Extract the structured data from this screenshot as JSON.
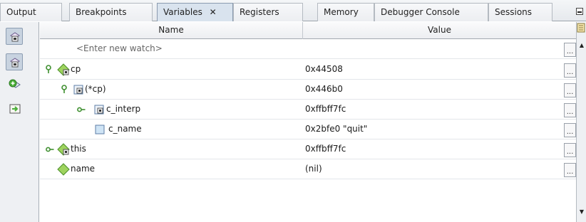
{
  "tabs": [
    {
      "label": "Output"
    },
    {
      "label": "Breakpoints"
    },
    {
      "label": "Variables",
      "active": true,
      "close": "✕"
    },
    {
      "label": "Registers"
    },
    {
      "label": "Memory"
    },
    {
      "label": "Debugger Console"
    },
    {
      "label": "Sessions"
    }
  ],
  "table": {
    "columns": {
      "name": "Name",
      "value": "Value"
    },
    "new_watch_placeholder": "<Enter new watch>",
    "ellipsis": "...",
    "rows": [
      {
        "name": "cp",
        "value": "0x44508"
      },
      {
        "name": "(*cp)",
        "value": "0x446b0"
      },
      {
        "name": "c_interp",
        "value": "0xffbff7fc"
      },
      {
        "name": "c_name",
        "value": "0x2bfe0 \"quit\""
      },
      {
        "name": "this",
        "value": "0xffbff7fc"
      },
      {
        "name": "name",
        "value": "(nil)"
      }
    ]
  },
  "colors": {
    "accent_green": "#4caf3a",
    "active_tab": "#d9e3ee",
    "selected_tool": "#c8d3e0"
  },
  "icons": [
    "watch-icon",
    "local-variable-icon",
    "field-icon",
    "pin-icon",
    "expander-icon",
    "collapse-icon"
  ]
}
